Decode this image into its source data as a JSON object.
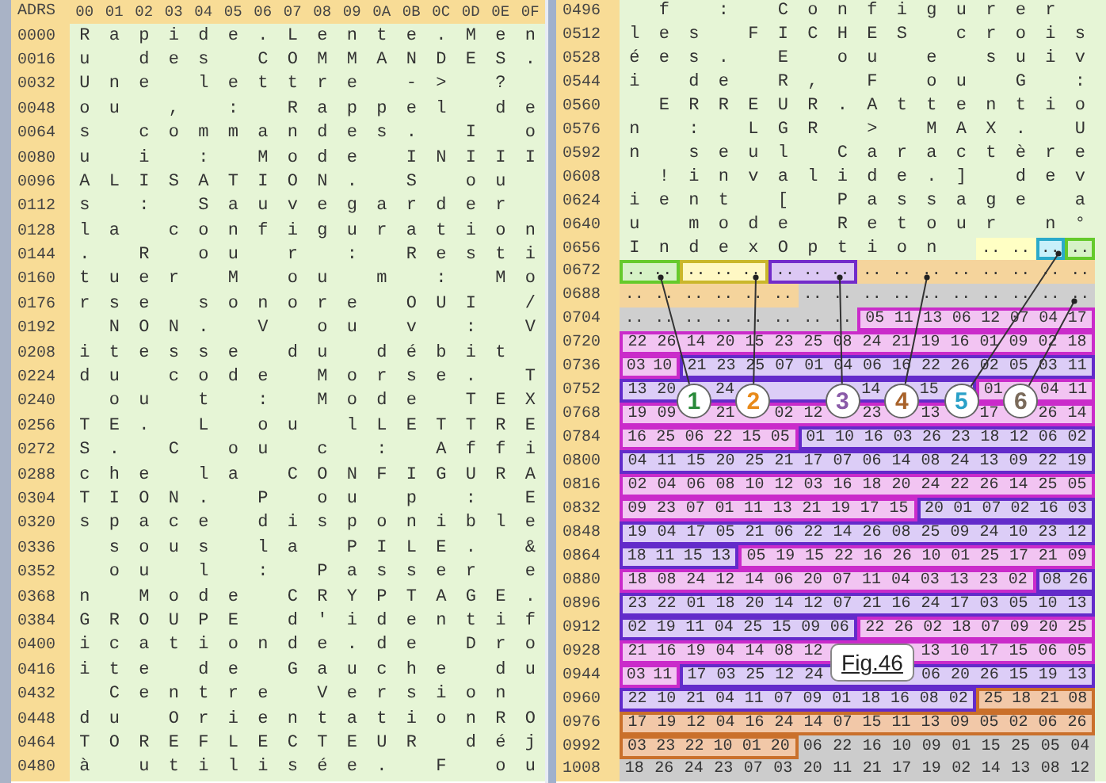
{
  "left_panel": {
    "header": {
      "address": "ADRS",
      "columns": [
        "00",
        "01",
        "02",
        "03",
        "04",
        "05",
        "06",
        "07",
        "08",
        "09",
        "0A",
        "0B",
        "0C",
        "0D",
        "0E",
        "0F"
      ]
    },
    "rows": [
      {
        "address": "0000",
        "text": "Rapide.Lente.Men"
      },
      {
        "address": "0016",
        "text": "u des COMMANDES."
      },
      {
        "address": "0032",
        "text": "Une lettre -> ? "
      },
      {
        "address": "0048",
        "text": "ou , : Rappel de"
      },
      {
        "address": "0064",
        "text": "s commandes. I o"
      },
      {
        "address": "0080",
        "text": "u i : Mode INIII"
      },
      {
        "address": "0096",
        "text": "ALISATION. S ou "
      },
      {
        "address": "0112",
        "text": "s : Sauvegarder "
      },
      {
        "address": "0128",
        "text": "la configuration"
      },
      {
        "address": "0144",
        "text": ". R ou r : Resti"
      },
      {
        "address": "0160",
        "text": "tuer M ou m : Mo"
      },
      {
        "address": "0176",
        "text": "rse sonore OUI /"
      },
      {
        "address": "0192",
        "text": " NON. V ou v : V"
      },
      {
        "address": "0208",
        "text": "itesse du débit "
      },
      {
        "address": "0224",
        "text": "du code Morse. T"
      },
      {
        "address": "0240",
        "text": " ou t : Mode TEX"
      },
      {
        "address": "0256",
        "text": "TE. L ou lLETTRE"
      },
      {
        "address": "0272",
        "text": "S. C ou c : Affi"
      },
      {
        "address": "0288",
        "text": "che la CONFIGURA"
      },
      {
        "address": "0304",
        "text": "TION. P ou p : E"
      },
      {
        "address": "0320",
        "text": "space disponible"
      },
      {
        "address": "0336",
        "text": " sous la PILE. &"
      },
      {
        "address": "0352",
        "text": " ou l : Passer e"
      },
      {
        "address": "0368",
        "text": "n Mode CRYPTAGE."
      },
      {
        "address": "0384",
        "text": "GROUPE d'identif"
      },
      {
        "address": "0400",
        "text": "icationde.de Dro"
      },
      {
        "address": "0416",
        "text": "ite de Gauche du"
      },
      {
        "address": "0432",
        "text": " Centre Version "
      },
      {
        "address": "0448",
        "text": "du OrientationRO"
      },
      {
        "address": "0464",
        "text": "TOREFLECTEUR déj"
      },
      {
        "address": "0480",
        "text": "à utilisée. F ou"
      }
    ]
  },
  "right_panel": {
    "rows": [
      {
        "address": "0496",
        "text": " f : Configurer "
      },
      {
        "address": "0512",
        "text": "les FICHES crois"
      },
      {
        "address": "0528",
        "text": "ées. E ou e suiv"
      },
      {
        "address": "0544",
        "text": "i de R, F ou G :"
      },
      {
        "address": "0560",
        "text": " ERREUR.Attentio"
      },
      {
        "address": "0576",
        "text": "n : LGR > MAX. U"
      },
      {
        "address": "0592",
        "text": "n seul Caractère"
      },
      {
        "address": "0608",
        "text": " !invalide.] dev"
      },
      {
        "address": "0624",
        "text": "ient [ Passage a"
      },
      {
        "address": "0640",
        "text": "u mode Retour n°"
      },
      {
        "address": "0656",
        "text": "IndexOption ",
        "segments": [
          {
            "color": "#ffffc4",
            "outlined": false,
            "cells": [
              "..",
              ".."
            ]
          },
          {
            "color": "#c8f0fa",
            "outlined": true,
            "cells": [
              ".."
            ]
          },
          {
            "color": "#d6f2c6",
            "outlined": true,
            "cells": [
              ".."
            ]
          }
        ]
      },
      {
        "address": "0672",
        "segments": [
          {
            "color": "#d6f2c6",
            "outlined": true,
            "cells": [
              "..",
              ".."
            ]
          },
          {
            "color": "#fff8c4",
            "outlined": true,
            "cells": [
              "..",
              "..",
              ".."
            ]
          },
          {
            "color": "#dcc8f4",
            "outlined": true,
            "cells": [
              "..",
              "..",
              ".."
            ]
          },
          {
            "color": "#f5d49c",
            "outlined": false,
            "cells": [
              "..",
              "..",
              "..",
              "..",
              "..",
              "..",
              "..",
              ".."
            ]
          }
        ]
      },
      {
        "address": "0688",
        "segments": [
          {
            "color": "#f5d49c",
            "outlined": false,
            "cells": [
              "..",
              "..",
              "..",
              "..",
              "..",
              ".."
            ]
          },
          {
            "color": "#cfcfcf",
            "outlined": false,
            "cells": [
              "..",
              "..",
              "..",
              "..",
              "..",
              "..",
              "..",
              "..",
              "..",
              ".."
            ]
          }
        ]
      },
      {
        "address": "0704",
        "segments": [
          {
            "color": "#cfcfcf",
            "outlined": false,
            "cells": [
              "..",
              "..",
              "..",
              "..",
              "..",
              "..",
              "..",
              ".."
            ]
          },
          {
            "color": "#f2c4f2",
            "outlined": true,
            "cells": [
              "05",
              "11",
              "13",
              "06",
              "12",
              "07",
              "04",
              "17"
            ]
          }
        ]
      },
      {
        "address": "0720",
        "segments": [
          {
            "color": "#f2c4f2",
            "outlined": true,
            "cells": [
              "22",
              "26",
              "14",
              "20",
              "15",
              "23",
              "25",
              "08",
              "24",
              "21",
              "19",
              "16",
              "01",
              "09",
              "02",
              "18"
            ]
          }
        ]
      },
      {
        "address": "0736",
        "segments": [
          {
            "color": "#f2c4f2",
            "outlined": true,
            "cells": [
              "03",
              "10"
            ]
          },
          {
            "color": "#dccdf7",
            "outlined": true,
            "cells": [
              "21",
              "23",
              "25",
              "07",
              "01",
              "04",
              "06",
              "16",
              "22",
              "26",
              "02",
              "05",
              "03",
              "11"
            ]
          }
        ]
      },
      {
        "address": "0752",
        "segments": [
          {
            "color": "#dccdf7",
            "outlined": true,
            "cells": [
              "13",
              "20",
              null,
              "24",
              null,
              null,
              null,
              null,
              "14",
              null,
              "15",
              null
            ]
          },
          {
            "color": "#f2c4f2",
            "outlined": true,
            "cells": [
              "01",
              null,
              "04",
              "11"
            ]
          }
        ]
      },
      {
        "address": "0768",
        "segments": [
          {
            "color": "#f2c4f2",
            "outlined": true,
            "cells": [
              "19",
              "09",
              null,
              "21",
              null,
              "02",
              "12",
              null,
              "23",
              null,
              "13",
              null,
              "17",
              null,
              "26",
              "14"
            ]
          }
        ]
      },
      {
        "address": "0784",
        "segments": [
          {
            "color": "#f2c4f2",
            "outlined": true,
            "cells": [
              "16",
              "25",
              "06",
              "22",
              "15",
              "05"
            ]
          },
          {
            "color": "#dccdf7",
            "outlined": true,
            "cells": [
              "01",
              "10",
              "16",
              "03",
              "26",
              "23",
              "18",
              "12",
              "06",
              "02"
            ]
          }
        ]
      },
      {
        "address": "0800",
        "segments": [
          {
            "color": "#dccdf7",
            "outlined": true,
            "cells": [
              "04",
              "11",
              "15",
              "20",
              "25",
              "21",
              "17",
              "07",
              "06",
              "14",
              "08",
              "24",
              "13",
              "09",
              "22",
              "19"
            ]
          }
        ]
      },
      {
        "address": "0816",
        "segments": [
          {
            "color": "#f2c4f2",
            "outlined": true,
            "cells": [
              "02",
              "04",
              "06",
              "08",
              "10",
              "12",
              "03",
              "16",
              "18",
              "20",
              "24",
              "22",
              "26",
              "14",
              "25",
              "05"
            ]
          }
        ]
      },
      {
        "address": "0832",
        "segments": [
          {
            "color": "#f2c4f2",
            "outlined": true,
            "cells": [
              "09",
              "23",
              "07",
              "01",
              "11",
              "13",
              "21",
              "19",
              "17",
              "15"
            ]
          },
          {
            "color": "#dccdf7",
            "outlined": true,
            "cells": [
              "20",
              "01",
              "07",
              "02",
              "16",
              "03"
            ]
          }
        ]
      },
      {
        "address": "0848",
        "segments": [
          {
            "color": "#dccdf7",
            "outlined": true,
            "cells": [
              "19",
              "04",
              "17",
              "05",
              "21",
              "06",
              "22",
              "14",
              "26",
              "08",
              "25",
              "09",
              "24",
              "10",
              "23",
              "12"
            ]
          }
        ]
      },
      {
        "address": "0864",
        "segments": [
          {
            "color": "#dccdf7",
            "outlined": true,
            "cells": [
              "18",
              "11",
              "15",
              "13"
            ]
          },
          {
            "color": "#f2c4f2",
            "outlined": true,
            "cells": [
              "05",
              "19",
              "15",
              "22",
              "16",
              "26",
              "10",
              "01",
              "25",
              "17",
              "21",
              "09"
            ]
          }
        ]
      },
      {
        "address": "0880",
        "segments": [
          {
            "color": "#f2c4f2",
            "outlined": true,
            "cells": [
              "18",
              "08",
              "24",
              "12",
              "14",
              "06",
              "20",
              "07",
              "11",
              "04",
              "03",
              "13",
              "23",
              "02"
            ]
          },
          {
            "color": "#dccdf7",
            "outlined": true,
            "cells": [
              "08",
              "26"
            ]
          }
        ]
      },
      {
        "address": "0896",
        "segments": [
          {
            "color": "#dccdf7",
            "outlined": true,
            "cells": [
              "23",
              "22",
              "01",
              "18",
              "20",
              "14",
              "12",
              "07",
              "21",
              "16",
              "24",
              "17",
              "03",
              "05",
              "10",
              "13"
            ]
          }
        ]
      },
      {
        "address": "0912",
        "segments": [
          {
            "color": "#dccdf7",
            "outlined": true,
            "cells": [
              "02",
              "19",
              "11",
              "04",
              "25",
              "15",
              "09",
              "06"
            ]
          },
          {
            "color": "#f2c4f2",
            "outlined": true,
            "cells": [
              "22",
              "26",
              "02",
              "18",
              "07",
              "09",
              "20",
              "25"
            ]
          }
        ]
      },
      {
        "address": "0928",
        "segments": [
          {
            "color": "#f2c4f2",
            "outlined": true,
            "cells": [
              "21",
              "16",
              "19",
              "04",
              "14",
              "08",
              "12",
              null,
              null,
              null,
              "13",
              "10",
              "17",
              "15",
              "06",
              "05"
            ]
          }
        ]
      },
      {
        "address": "0944",
        "segments": [
          {
            "color": "#f2c4f2",
            "outlined": true,
            "cells": [
              "03",
              "11"
            ]
          },
          {
            "color": "#dccdf7",
            "outlined": true,
            "cells": [
              "17",
              "03",
              "25",
              "12",
              "24",
              null,
              null,
              null,
              "06",
              "20",
              "26",
              "15",
              "19",
              "13"
            ]
          }
        ]
      },
      {
        "address": "0960",
        "segments": [
          {
            "color": "#dccdf7",
            "outlined": true,
            "cells": [
              "22",
              "10",
              "21",
              "04",
              "11",
              "07",
              "09",
              "01",
              "18",
              "16",
              "08",
              "02"
            ]
          },
          {
            "color": "#f2c8a8",
            "outlined": true,
            "cells": [
              "25",
              "18",
              "21",
              "08"
            ]
          }
        ]
      },
      {
        "address": "0976",
        "segments": [
          {
            "color": "#f2c8a8",
            "outlined": true,
            "cells": [
              "17",
              "19",
              "12",
              "04",
              "16",
              "24",
              "14",
              "07",
              "15",
              "11",
              "13",
              "09",
              "05",
              "02",
              "06",
              "26"
            ]
          }
        ]
      },
      {
        "address": "0992",
        "segments": [
          {
            "color": "#f2c8a8",
            "outlined": true,
            "cells": [
              "03",
              "23",
              "22",
              "10",
              "01",
              "20"
            ]
          },
          {
            "color": "#cccccc",
            "outlined": false,
            "cells": [
              "06",
              "22",
              "16",
              "10",
              "09",
              "01",
              "15",
              "25",
              "05",
              "04"
            ]
          }
        ]
      },
      {
        "address": "1008",
        "segments": [
          {
            "color": "#cccccc",
            "outlined": false,
            "cells": [
              "18",
              "26",
              "24",
              "23",
              "07",
              "03",
              "20",
              "11",
              "21",
              "17",
              "19",
              "02",
              "14",
              "13",
              "08",
              "12"
            ]
          }
        ]
      }
    ]
  },
  "callouts": [
    {
      "label": "1",
      "color": "#2a8a3a"
    },
    {
      "label": "2",
      "color": "#e88a1a"
    },
    {
      "label": "3",
      "color": "#8a5aa8"
    },
    {
      "label": "4",
      "color": "#a8622a"
    },
    {
      "label": "5",
      "color": "#2aa0c8"
    },
    {
      "label": "6",
      "color": "#7a6a5a"
    }
  ],
  "figure_label": "Fig.46"
}
